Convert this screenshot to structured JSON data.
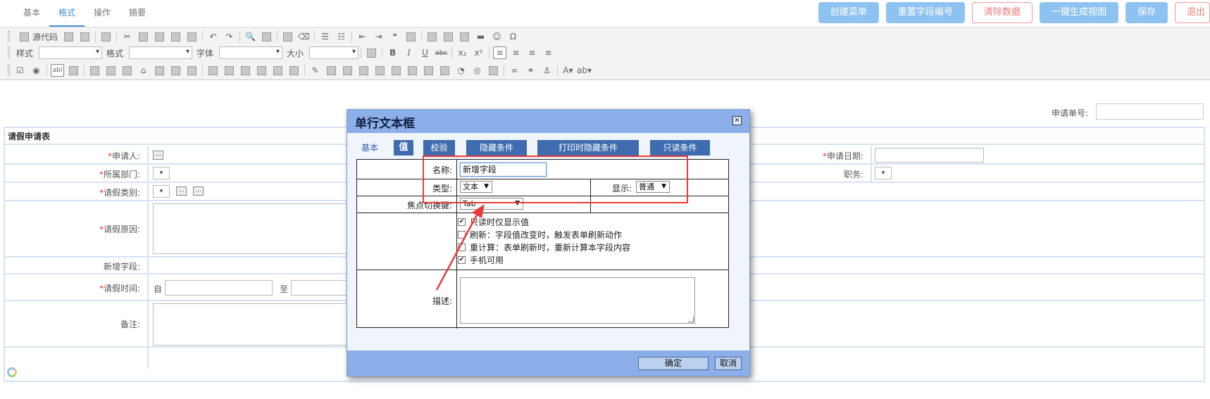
{
  "tabs": [
    "基本",
    "格式",
    "操作",
    "摘要"
  ],
  "actions": {
    "create_menu": "创建菜单",
    "reset_field_no": "重置字段编号",
    "clear_data": "清除数据",
    "gen_view": "一键生成视图",
    "save": "保存",
    "exit": "退出"
  },
  "toolbar": {
    "source": "源代码",
    "style": "样式",
    "format": "格式",
    "font": "字体",
    "size": "大小",
    "bold": "B",
    "italic": "I",
    "underline": "U",
    "strike": "abc",
    "sub": "x₂",
    "sup": "x²",
    "omega": "Ω",
    "quote": "❝"
  },
  "form": {
    "apply_no_label": "申请单号:",
    "title": "请假申请表",
    "applicant": "申请人:",
    "dept": "所属部门:",
    "leave_type": "请假类别:",
    "reason": "请假原因:",
    "new_field": "新增字段:",
    "leave_time": "请假时间:",
    "from": "自",
    "to": "至",
    "remark": "备注:",
    "apply_date": "申请日期:",
    "position": "职务:",
    "required_mark": "*"
  },
  "dialog": {
    "title": "单行文本框",
    "close": "✕",
    "tabs": {
      "basic": "基本",
      "value": "值",
      "validate": "校验",
      "hide_cond": "隐藏条件",
      "print_hide_cond": "打印时隐藏条件",
      "readonly_cond": "只读条件"
    },
    "name_label": "名称:",
    "name_value": "新增字段",
    "type_label": "类型:",
    "type_value": "文本",
    "display_label": "显示:",
    "display_value": "普通",
    "focus_label": "焦点切换键:",
    "focus_value": "Tab",
    "opt_readonly": "只读时仅显示值",
    "opt_refresh": "刷新：字段值改变时，触发表单刷新动作",
    "opt_recalc": "重计算：表单刷新时，重新计算本字段内容",
    "opt_mobile": "手机可用",
    "desc_label": "描述:",
    "ok": "确定",
    "cancel": "取消",
    "check_mark": "✔",
    "arrow": "▼"
  },
  "colors": {
    "accent": "#3f8fd8",
    "action_button": "#8ec3f1",
    "danger": "#f07a78",
    "dialog_header": "#8caee9",
    "dialog_tab": "#3e6cae",
    "annotation": "#e63b3b"
  }
}
